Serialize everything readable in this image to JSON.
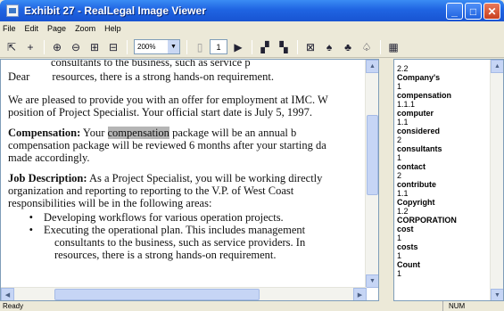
{
  "window": {
    "title": "Exhibit 27 - RealLegal Image Viewer"
  },
  "menu": [
    "File",
    "Edit",
    "Page",
    "Zoom",
    "Help"
  ],
  "toolbar": {
    "zoom_value": "200%",
    "page_number": "1"
  },
  "document": {
    "top_line": "consultants to the business, such as service p",
    "dear": "Dear",
    "dear_tail": "resources, there is a strong hands-on requirement.",
    "para1_l1": "We are pleased to provide you with an offer for employment at IMC. W",
    "para1_l2": "position of Project Specialist. Your official start date is July 5, 1997.",
    "comp_heading": "Compensation:",
    "comp_pre": " Your ",
    "comp_highlight": "compensation",
    "comp_post": " package will be an annual b",
    "comp_l2": "compensation package will be reviewed 6 months after your starting da",
    "comp_l3": "made accordingly.",
    "job_heading": "Job Description:",
    "job_l1": " As a Project Specialist, you will be working directly",
    "job_l2": "organization and reporting to reporting to the V.P. of West Coast",
    "job_l3": "responsibilities will be in the following areas:",
    "bullet1": "Developing workflows for various operation projects.",
    "bullet2_l1": "Executing the operational plan. This includes management",
    "bullet2_l2": "consultants to the business, such as service providers. In",
    "bullet2_l3": "resources, there is a strong hands-on requirement."
  },
  "wordlist": [
    {
      "word": "",
      "count": "2.2"
    },
    {
      "word": "Company's",
      "count": "1"
    },
    {
      "word": "compensation",
      "count": "1.1.1"
    },
    {
      "word": "computer",
      "count": "1.1"
    },
    {
      "word": "considered",
      "count": "2"
    },
    {
      "word": "consultants",
      "count": "1"
    },
    {
      "word": "contact",
      "count": "2"
    },
    {
      "word": "contribute",
      "count": "1.1"
    },
    {
      "word": "Copyright",
      "count": "1.2"
    },
    {
      "word": "CORPORATION",
      "count": ""
    },
    {
      "word": "cost",
      "count": "1"
    },
    {
      "word": "costs",
      "count": "1"
    },
    {
      "word": "Count",
      "count": "1"
    }
  ],
  "status": {
    "text": "Ready",
    "num": "NUM"
  }
}
